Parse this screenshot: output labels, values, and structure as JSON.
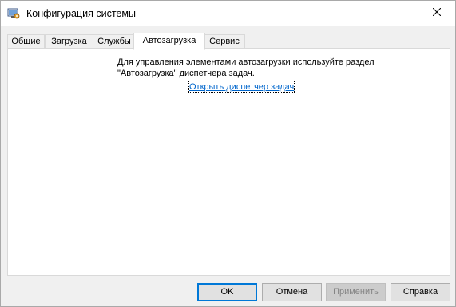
{
  "window": {
    "title": "Конфигурация системы"
  },
  "icons": {
    "app": "system-configuration-icon",
    "close": "close-icon"
  },
  "tabs": [
    {
      "label": "Общие",
      "active": false
    },
    {
      "label": "Загрузка",
      "active": false
    },
    {
      "label": "Службы",
      "active": false
    },
    {
      "label": "Автозагрузка",
      "active": true
    },
    {
      "label": "Сервис",
      "active": false
    }
  ],
  "startup": {
    "line1": "Для управления элементами автозагрузки используйте раздел",
    "line2": "\"Автозагрузка\" диспетчера задач.",
    "link": "Открыть диспетчер задач"
  },
  "buttons": {
    "ok": "OK",
    "cancel": "Отмена",
    "apply": "Применить",
    "help": "Справка"
  },
  "colors": {
    "link": "#0066cc",
    "default_button_border": "#0078d7"
  }
}
